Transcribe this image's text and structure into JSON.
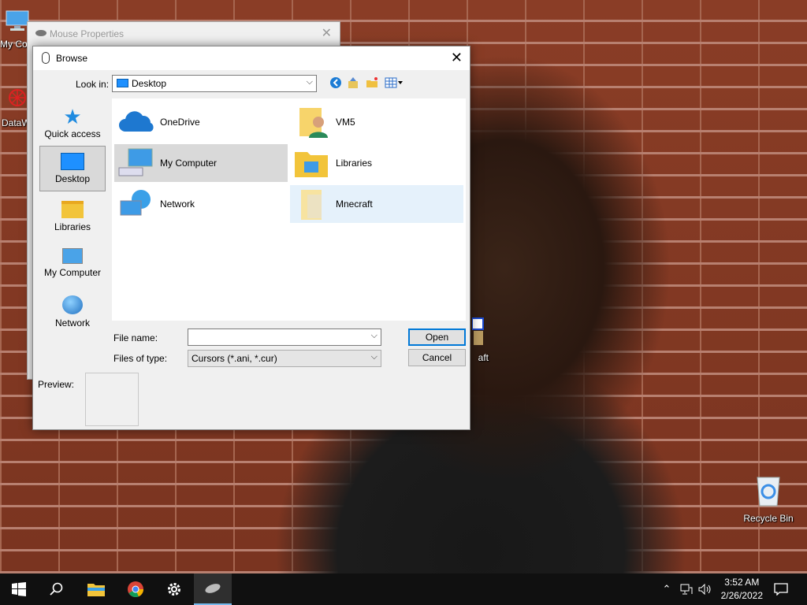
{
  "desktop": {
    "icons": [
      {
        "label": "My Co"
      },
      {
        "label": "DataW"
      },
      {
        "label": "aft"
      },
      {
        "label": "Recycle Bin"
      }
    ]
  },
  "mouse_properties": {
    "title": "Mouse Properties"
  },
  "browse_dialog": {
    "title": "Browse",
    "look_in_label": "Look in:",
    "look_in_value": "Desktop",
    "places": [
      {
        "label": "Quick access"
      },
      {
        "label": "Desktop"
      },
      {
        "label": "Libraries"
      },
      {
        "label": "My Computer"
      },
      {
        "label": "Network"
      }
    ],
    "files": [
      {
        "label": "OneDrive"
      },
      {
        "label": "VM5"
      },
      {
        "label": "My Computer"
      },
      {
        "label": "Libraries"
      },
      {
        "label": "Network"
      },
      {
        "label": "Mnecraft"
      }
    ],
    "file_name_label": "File name:",
    "file_name_value": "",
    "files_of_type_label": "Files of type:",
    "files_of_type_value": "Cursors (*.ani, *.cur)",
    "open_label": "Open",
    "cancel_label": "Cancel",
    "preview_label": "Preview:"
  },
  "taskbar": {
    "time": "3:52 AM",
    "date": "2/26/2022"
  }
}
